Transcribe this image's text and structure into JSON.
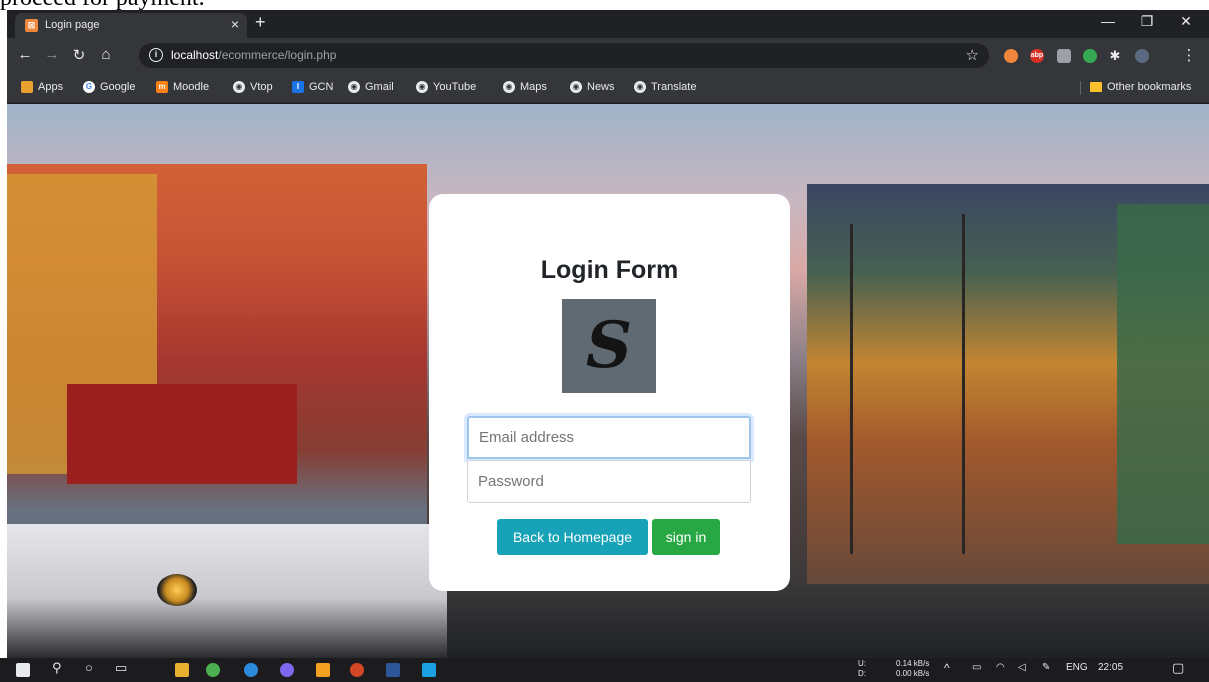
{
  "document_text": "proceed for payment.",
  "browser": {
    "tab_title": "Login page",
    "tab_close": "×",
    "new_tab": "+",
    "window_controls": [
      "—",
      "❐",
      "✕"
    ],
    "url_host": "localhost",
    "url_path": "/ecommerce/login.php",
    "bookmarks": [
      "Apps",
      "Google",
      "Moodle",
      "Vtop",
      "GCN",
      "Gmail",
      "YouTube",
      "Maps",
      "News",
      "Translate"
    ],
    "other_bookmarks": "Other bookmarks",
    "extensions": [
      "abp"
    ]
  },
  "login": {
    "title": "Login Form",
    "logo_letter": "S",
    "email_placeholder": "Email address",
    "password_placeholder": "Password",
    "back_button": "Back to Homepage",
    "signin_button": "sign in"
  },
  "taskbar": {
    "upload_label": "U:",
    "download_label": "D:",
    "upload_speed": "0.14 kB/s",
    "download_speed": "0.00 kB/s",
    "language": "ENG",
    "time": "22:05"
  },
  "colors": {
    "info_button": "#17a2b8",
    "success_button": "#28a745",
    "logo_bg": "#5f6a72"
  }
}
